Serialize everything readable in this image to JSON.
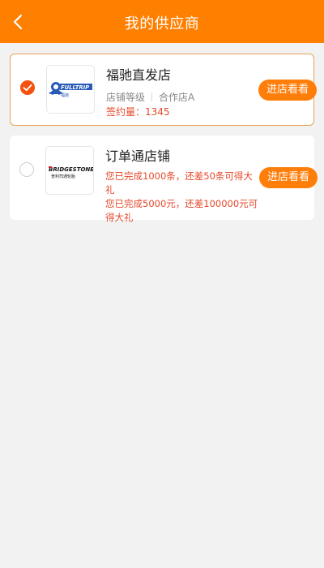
{
  "header": {
    "title": "我的供应商",
    "back_icon": "chevron-left-icon"
  },
  "colors": {
    "brand": "#ff7f00",
    "accent_red": "#e5482a",
    "selected_border": "#e8a255"
  },
  "suppliers": [
    {
      "name": "福驰直发店",
      "selected": true,
      "logo_text": "FULLTRIP",
      "logo_subtext": "福驰",
      "level_label": "店铺等级",
      "level_value": "合作店A",
      "contract_label": "签约量：",
      "contract_value": "1345",
      "visit_label": "进店看看"
    },
    {
      "name": "订单通店铺",
      "selected": false,
      "logo_text": "BRIDGESTONE",
      "logo_subtext": "普利司通轮胎",
      "promo_line1": "您已完成1000条，还差50条可得大礼",
      "promo_line2": "您已完成5000元，还差100000元可得大礼",
      "visit_label": "进店看看"
    }
  ]
}
